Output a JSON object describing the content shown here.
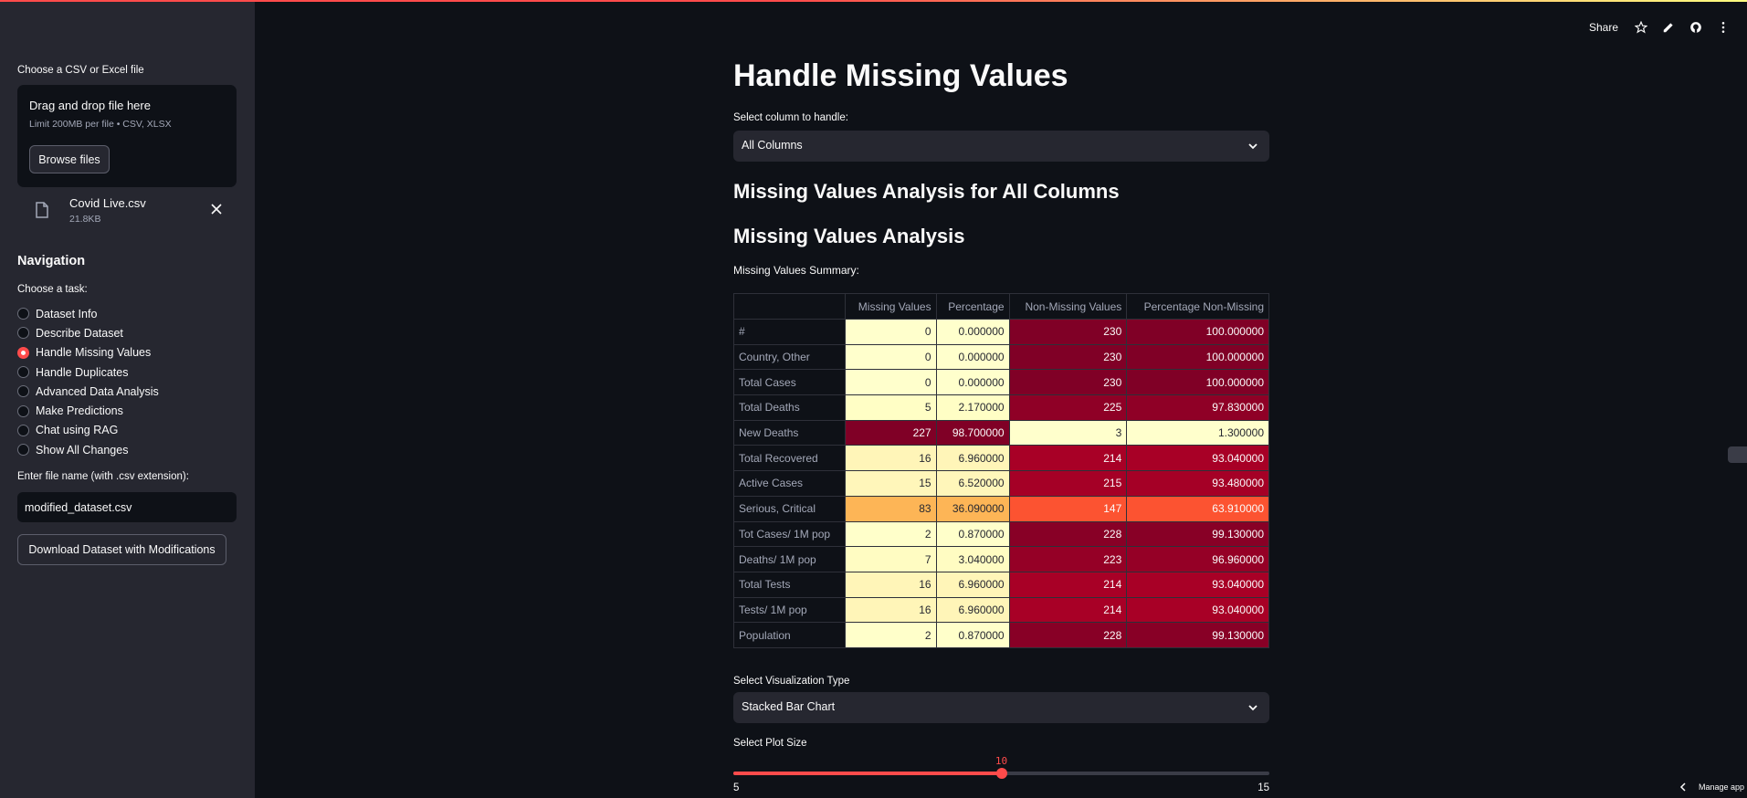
{
  "colors": {
    "accent": "#ff4b4b",
    "sidebar_bg": "#262730",
    "main_bg": "#0e1117"
  },
  "toolbar": {
    "share_label": "Share"
  },
  "sidebar": {
    "uploader_label": "Choose a CSV or Excel file",
    "dropzone_title": "Drag and drop file here",
    "dropzone_sub": "Limit 200MB per file • CSV, XLSX",
    "browse_label": "Browse files",
    "file_name": "Covid Live.csv",
    "file_size": "21.8KB",
    "nav_title": "Navigation",
    "task_label": "Choose a task:",
    "tasks": [
      {
        "label": "Dataset Info",
        "selected": false
      },
      {
        "label": "Describe Dataset",
        "selected": false
      },
      {
        "label": "Handle Missing Values",
        "selected": true
      },
      {
        "label": "Handle Duplicates",
        "selected": false
      },
      {
        "label": "Advanced Data Analysis",
        "selected": false
      },
      {
        "label": "Make Predictions",
        "selected": false
      },
      {
        "label": "Chat using RAG",
        "selected": false
      },
      {
        "label": "Show All Changes",
        "selected": false
      }
    ],
    "filename_label": "Enter file name (with .csv extension):",
    "filename_value": "modified_dataset.csv",
    "download_label": "Download Dataset with Modifications"
  },
  "main": {
    "title": "Handle Missing Values",
    "column_label": "Select column to handle:",
    "column_value": "All Columns",
    "analysis_heading": "Missing Values Analysis for All Columns",
    "analysis_subheading": "Missing Values Analysis",
    "summary_label": "Missing Values Summary:",
    "table": {
      "headers": [
        "",
        "Missing Values",
        "Percentage",
        "Non-Missing Values",
        "Percentage Non-Missing"
      ],
      "rows": [
        {
          "name": "#",
          "missing": "0",
          "pct": "0.000000",
          "nonmissing": "230",
          "pct_non": "100.000000",
          "cols": [
            "#ffffcc",
            "#ffffcc",
            "#800026",
            "#800026"
          ]
        },
        {
          "name": "Country, Other",
          "missing": "0",
          "pct": "0.000000",
          "nonmissing": "230",
          "pct_non": "100.000000",
          "cols": [
            "#ffffcc",
            "#ffffcc",
            "#800026",
            "#800026"
          ]
        },
        {
          "name": "Total Cases",
          "missing": "0",
          "pct": "0.000000",
          "nonmissing": "230",
          "pct_non": "100.000000",
          "cols": [
            "#ffffcc",
            "#ffffcc",
            "#800026",
            "#800026"
          ]
        },
        {
          "name": "Total Deaths",
          "missing": "5",
          "pct": "2.170000",
          "nonmissing": "225",
          "pct_non": "97.830000",
          "cols": [
            "#fffec5",
            "#fffec5",
            "#8f0026",
            "#8f0026"
          ]
        },
        {
          "name": "New Deaths",
          "missing": "227",
          "pct": "98.700000",
          "nonmissing": "3",
          "pct_non": "1.300000",
          "cols": [
            "#800026",
            "#800026",
            "#ffffcc",
            "#ffffcc"
          ]
        },
        {
          "name": "Total Recovered",
          "missing": "16",
          "pct": "6.960000",
          "nonmissing": "214",
          "pct_non": "93.040000",
          "cols": [
            "#fff5b8",
            "#fff5b8",
            "#a80026",
            "#a80026"
          ]
        },
        {
          "name": "Active Cases",
          "missing": "15",
          "pct": "6.520000",
          "nonmissing": "215",
          "pct_non": "93.480000",
          "cols": [
            "#fff6ba",
            "#fff6ba",
            "#a50026",
            "#a50026"
          ]
        },
        {
          "name": "Serious, Critical",
          "missing": "83",
          "pct": "36.090000",
          "nonmissing": "147",
          "pct_non": "63.910000",
          "cols": [
            "#fdb556",
            "#fdb556",
            "#fc5331",
            "#fc5331"
          ]
        },
        {
          "name": "Tot Cases/ 1M pop",
          "missing": "2",
          "pct": "0.870000",
          "nonmissing": "228",
          "pct_non": "99.130000",
          "cols": [
            "#ffffca",
            "#ffffca",
            "#880026",
            "#880026"
          ]
        },
        {
          "name": "Deaths/ 1M pop",
          "missing": "7",
          "pct": "3.040000",
          "nonmissing": "223",
          "pct_non": "96.960000",
          "cols": [
            "#fffcc2",
            "#fffcc2",
            "#950026",
            "#950026"
          ]
        },
        {
          "name": "Total Tests",
          "missing": "16",
          "pct": "6.960000",
          "nonmissing": "214",
          "pct_non": "93.040000",
          "cols": [
            "#fff5b8",
            "#fff5b8",
            "#a80026",
            "#a80026"
          ]
        },
        {
          "name": "Tests/ 1M pop",
          "missing": "16",
          "pct": "6.960000",
          "nonmissing": "214",
          "pct_non": "93.040000",
          "cols": [
            "#fff5b8",
            "#fff5b8",
            "#a80026",
            "#a80026"
          ]
        },
        {
          "name": "Population",
          "missing": "2",
          "pct": "0.870000",
          "nonmissing": "228",
          "pct_non": "99.130000",
          "cols": [
            "#ffffca",
            "#ffffca",
            "#880026",
            "#880026"
          ]
        }
      ]
    },
    "viz_label": "Select Visualization Type",
    "viz_value": "Stacked Bar Chart",
    "plot_size_label": "Select Plot Size",
    "slider": {
      "min": 5,
      "max": 15,
      "value": 10,
      "min_label": "5",
      "max_label": "15",
      "value_label": "10"
    }
  },
  "footer": {
    "manage_label": "Manage app"
  }
}
